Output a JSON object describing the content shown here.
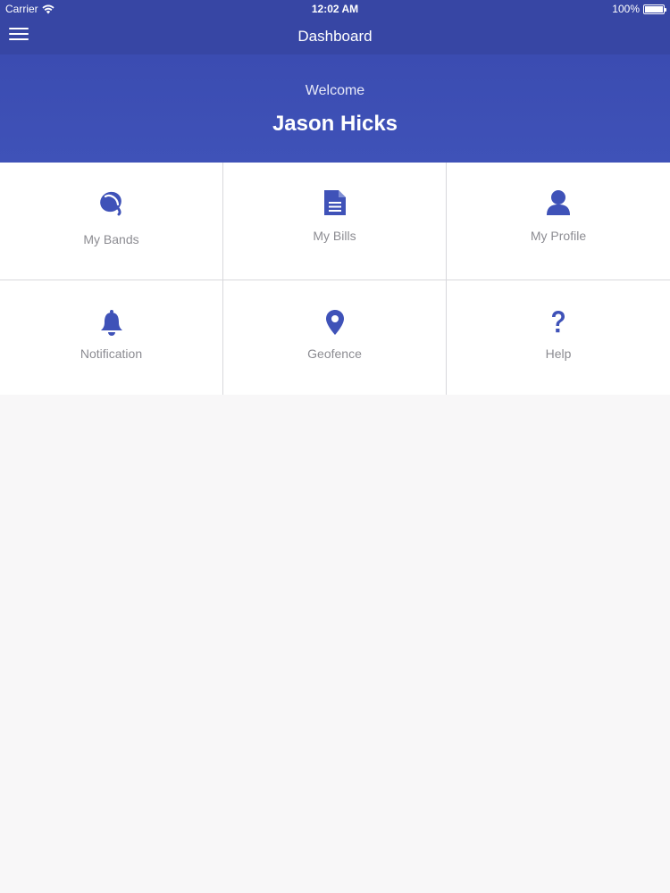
{
  "status_bar": {
    "carrier": "Carrier",
    "time": "12:02 AM",
    "battery": "100%",
    "battery_level": 1.0
  },
  "nav": {
    "title": "Dashboard",
    "menu_icon": "hamburger-menu-icon"
  },
  "banner": {
    "welcome": "Welcome",
    "user_name": "Jason Hicks"
  },
  "tiles": [
    {
      "label": "My Bands",
      "icon": "band-icon"
    },
    {
      "label": "My Bills",
      "icon": "document-icon"
    },
    {
      "label": "My Profile",
      "icon": "user-icon"
    },
    {
      "label": "Notification",
      "icon": "bell-icon"
    },
    {
      "label": "Geofence",
      "icon": "map-pin-icon"
    },
    {
      "label": "Help",
      "icon": "question-icon"
    }
  ],
  "colors": {
    "primary": "#3746a4",
    "banner": "#3f52b8",
    "icon": "#3f52b8",
    "label": "#8c8c92",
    "background": "#f8f7f8"
  }
}
